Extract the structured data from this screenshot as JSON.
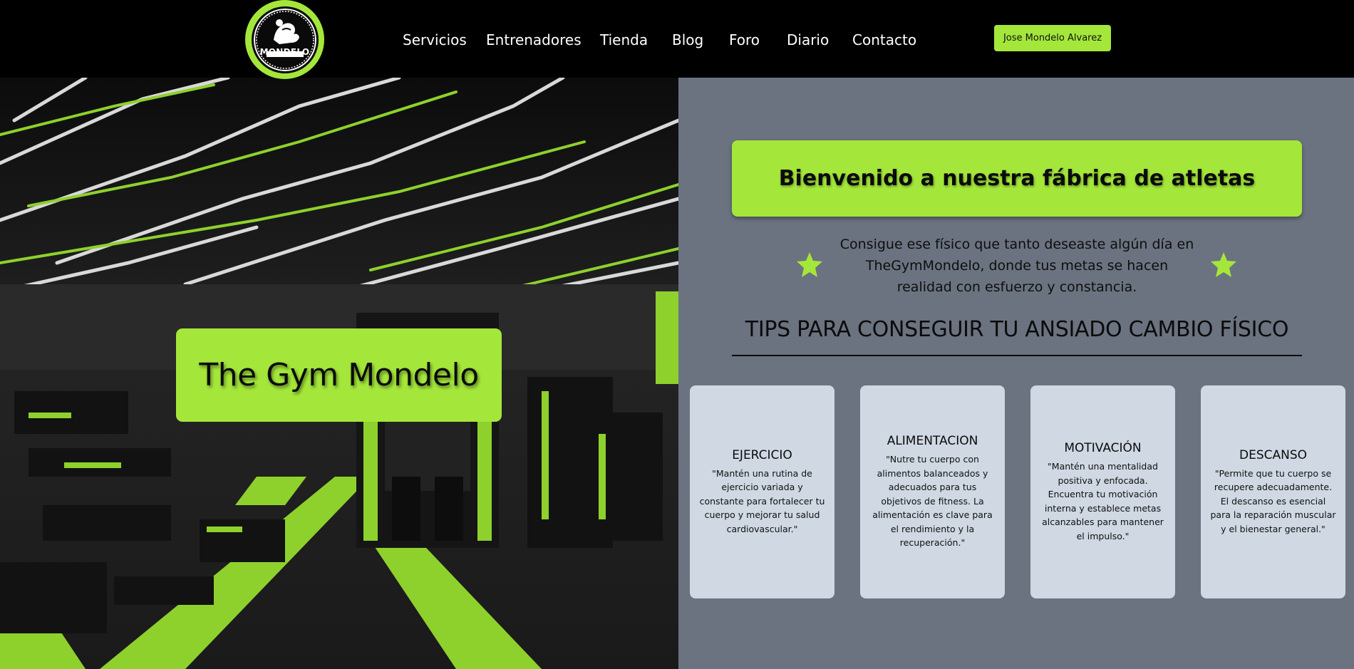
{
  "header": {
    "logo_text": "MONDELO",
    "nav": [
      {
        "label": "Servicios"
      },
      {
        "label": "Entrenadores"
      },
      {
        "label": "Tienda"
      },
      {
        "label": "Blog"
      },
      {
        "label": "Foro"
      },
      {
        "label": "Diario"
      },
      {
        "label": "Contacto"
      }
    ],
    "user_button": "Jose Mondelo Alvarez"
  },
  "hero": {
    "title": "The Gym Mondelo"
  },
  "panel": {
    "welcome": "Bienvenido a nuestra fábrica de atletas",
    "intro": "Consigue ese físico que tanto deseaste algún día en TheGymMondelo, donde tus metas se hacen realidad con esfuerzo y constancia.",
    "tips_title": "TIPS PARA CONSEGUIR TU ANSIADO CAMBIO FÍSICO",
    "cards": [
      {
        "title": "EJERCICIO",
        "text": "\"Mantén una rutina de ejercicio variada y constante para fortalecer tu cuerpo y mejorar tu salud cardiovascular.\""
      },
      {
        "title": "ALIMENTACION",
        "text": "\"Nutre tu cuerpo con alimentos balanceados y adecuados para tus objetivos de fitness. La alimentación es clave para el rendimiento y la recuperación.\""
      },
      {
        "title": "MOTIVACIÓN",
        "text": "\"Mantén una mentalidad positiva y enfocada. Encuentra tu motivación interna y establece metas alcanzables para mantener el impulso.\""
      },
      {
        "title": "DESCANSO",
        "text": "\"Permite que tu cuerpo se recupere adecuadamente. El descanso es esencial para la reparación muscular y el bienestar general.\""
      }
    ]
  },
  "colors": {
    "accent": "#a4e73a",
    "panel_bg": "#6b7380",
    "card_bg": "#cfd8e3",
    "header_bg": "#000000"
  },
  "icons": [
    "logo-emblem",
    "star-icon"
  ]
}
